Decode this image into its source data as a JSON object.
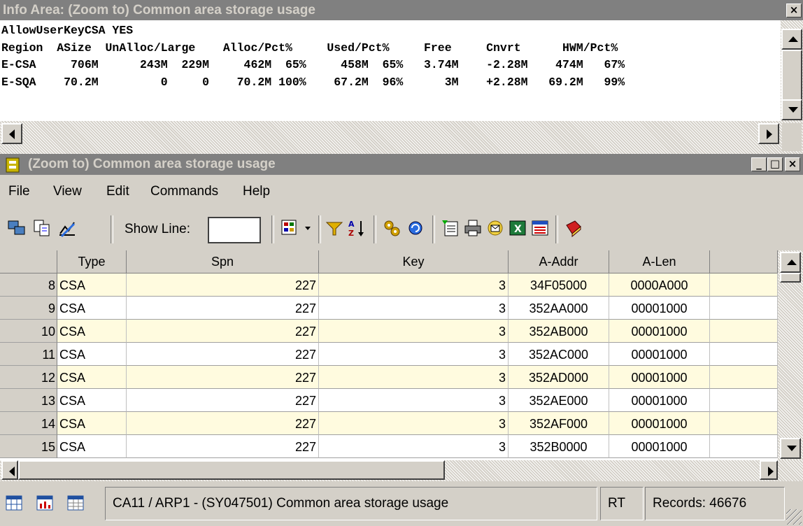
{
  "info_window": {
    "title": "Info Area: (Zoom to) Common area storage usage",
    "lines": [
      "AllowUserKeyCSA YES",
      "Region  ASize  UnAlloc/Large    Alloc/Pct%     Used/Pct%     Free     Cnvrt      HWM/Pct%",
      "E-CSA     706M      243M  229M     462M  65%     458M  65%   3.74M    -2.28M    474M   67%",
      "E-SQA    70.2M         0     0    70.2M 100%    67.2M  96%      3M    +2.28M   69.2M   99%"
    ]
  },
  "main_window": {
    "title": "(Zoom to) Common area storage usage",
    "menu": [
      "File",
      "View",
      "Edit",
      "Commands",
      "Help"
    ],
    "toolbar": {
      "show_line_label": "Show Line:",
      "show_line_value": ""
    },
    "table": {
      "columns": [
        "",
        "Type",
        "Spn",
        "Key",
        "A-Addr",
        "A-Len",
        ""
      ],
      "rows": [
        {
          "n": "8",
          "type": "CSA",
          "spn": "227",
          "key": "3",
          "addr": "34F05000",
          "len": "0000A000"
        },
        {
          "n": "9",
          "type": "CSA",
          "spn": "227",
          "key": "3",
          "addr": "352AA000",
          "len": "00001000"
        },
        {
          "n": "10",
          "type": "CSA",
          "spn": "227",
          "key": "3",
          "addr": "352AB000",
          "len": "00001000"
        },
        {
          "n": "11",
          "type": "CSA",
          "spn": "227",
          "key": "3",
          "addr": "352AC000",
          "len": "00001000"
        },
        {
          "n": "12",
          "type": "CSA",
          "spn": "227",
          "key": "3",
          "addr": "352AD000",
          "len": "00001000"
        },
        {
          "n": "13",
          "type": "CSA",
          "spn": "227",
          "key": "3",
          "addr": "352AE000",
          "len": "00001000"
        },
        {
          "n": "14",
          "type": "CSA",
          "spn": "227",
          "key": "3",
          "addr": "352AF000",
          "len": "00001000"
        },
        {
          "n": "15",
          "type": "CSA",
          "spn": "227",
          "key": "3",
          "addr": "352B0000",
          "len": "00001000"
        }
      ]
    },
    "status": {
      "description": "CA11 / ARP1 - (SY047501) Common area storage usage",
      "mode": "RT",
      "records": "Records: 46676"
    }
  },
  "colors": {
    "row_highlight": "#fffbdf",
    "title_inactive": "#808080"
  }
}
